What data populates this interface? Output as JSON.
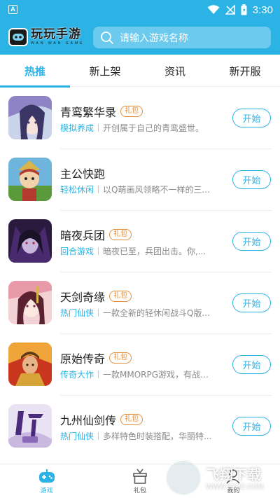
{
  "status_bar": {
    "left_icon_letter": "A",
    "time": "3:30",
    "icons": [
      "wifi-icon",
      "signal-icon",
      "battery-icon"
    ]
  },
  "header": {
    "logo_text": "玩玩手游",
    "logo_sub": "WAN WAN GAME",
    "search_placeholder": "请输入游戏名称"
  },
  "tabs": [
    {
      "label": "热推",
      "active": true
    },
    {
      "label": "新上架",
      "active": false
    },
    {
      "label": "资讯",
      "active": false
    },
    {
      "label": "新开服",
      "active": false
    }
  ],
  "games": [
    {
      "title": "青鸾繁华录",
      "badge": "礼包",
      "category": "模拟养成",
      "desc": "开创属于自己的青鸾盛世。",
      "button": "开始"
    },
    {
      "title": "主公快跑",
      "badge": "",
      "category": "轻松休闲",
      "desc": "以Q萌画风领略不一样的三...",
      "button": "开始"
    },
    {
      "title": "暗夜兵团",
      "badge": "礼包",
      "category": "回合游戏",
      "desc": "暗夜已至，兵团出击。你,...",
      "button": "开始"
    },
    {
      "title": "天剑奇缘",
      "badge": "礼包",
      "category": "热门仙侠",
      "desc": "一款全新的轻休闲战斗Q版...",
      "button": "开始"
    },
    {
      "title": "原始传奇",
      "badge": "礼包",
      "category": "传奇大作",
      "desc": "一款MMORPG游戏，有战士...",
      "button": "开始"
    },
    {
      "title": "九州仙剑传",
      "badge": "礼包",
      "category": "热门仙侠",
      "desc": "多样特色时装搭配，华丽特...",
      "button": "开始"
    }
  ],
  "bottom_nav": [
    {
      "label": "游戏",
      "icon": "gamepad-icon",
      "active": true
    },
    {
      "label": "礼包",
      "icon": "gift-icon",
      "active": false
    },
    {
      "label": "我的",
      "icon": "user-icon",
      "active": false
    }
  ],
  "watermark": {
    "title": "飞翔下载",
    "url": "WWW.FXXZ.COM"
  },
  "colors": {
    "accent": "#2bb3e6",
    "badge": "#e58c3b",
    "desc": "#8a8a8a"
  }
}
